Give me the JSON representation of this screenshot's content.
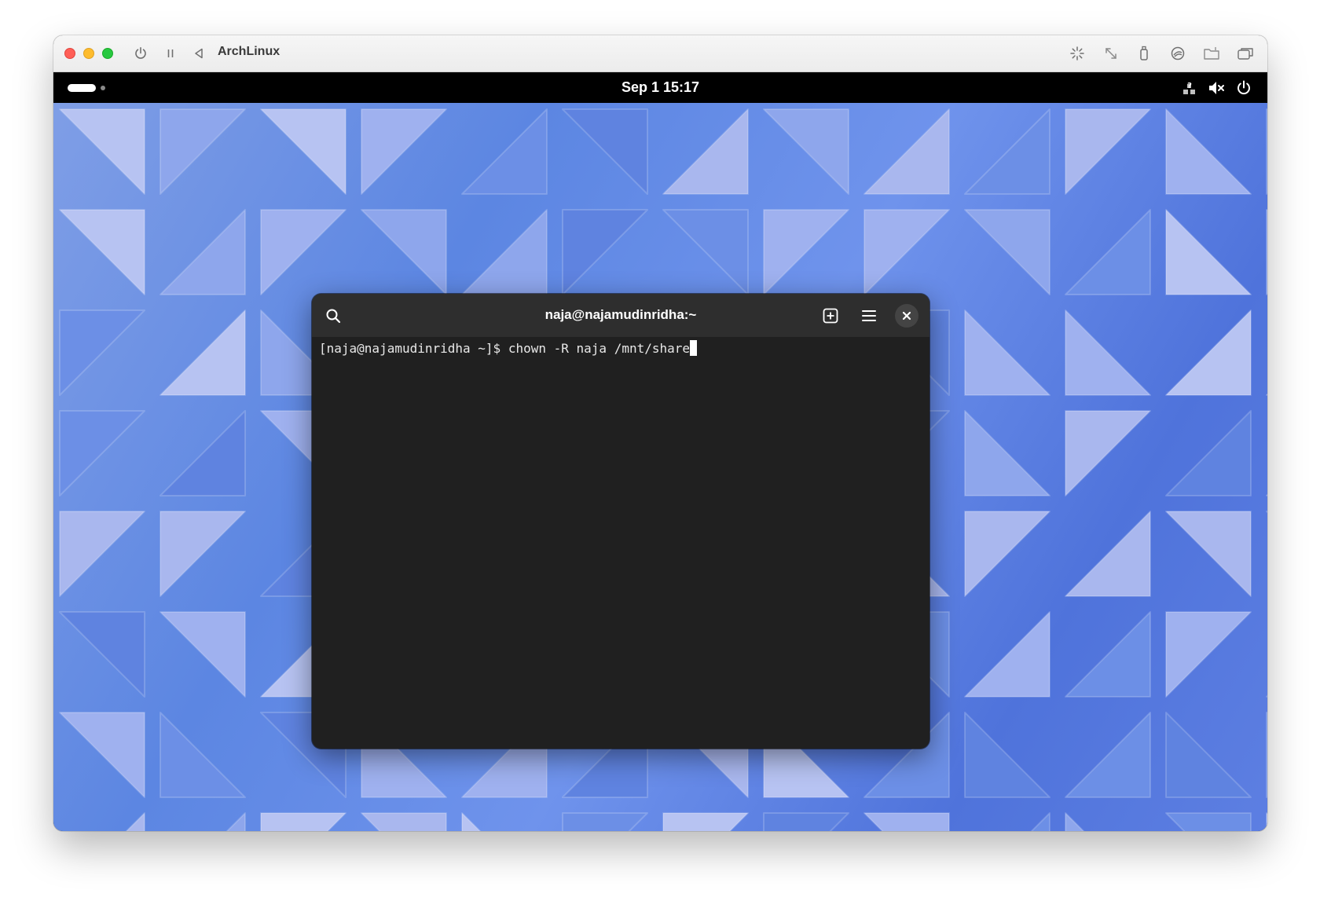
{
  "vm_window": {
    "title": "ArchLinux",
    "toolbar_left_icons": [
      "power-icon",
      "pause-icon",
      "back-icon"
    ],
    "toolbar_right_icons": [
      "brightness-icon",
      "resize-icon",
      "usb-icon",
      "network-icon",
      "shared-folder-icon",
      "windows-icon"
    ]
  },
  "top_bar": {
    "clock": "Sep 1 15:17",
    "tray_icons": [
      "network-unknown-icon",
      "volume-muted-icon",
      "power-icon"
    ]
  },
  "terminal": {
    "title": "naja@najamudinridha:~",
    "prompt": "[naja@najamudinridha ~]$ ",
    "command": "chown -R naja /mnt/share",
    "header_icons": [
      "search-icon",
      "new-tab-icon",
      "menu-icon",
      "close-icon"
    ]
  }
}
